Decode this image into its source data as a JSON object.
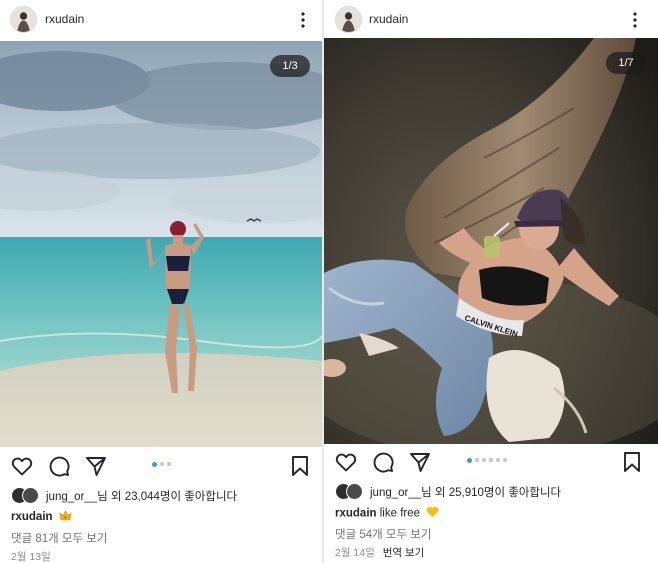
{
  "posts": [
    {
      "username": "rxudain",
      "counter": "1/3",
      "photo_alt": "beach photo",
      "slide_count": 3,
      "active_slide": 1,
      "likes_users": "jung_or__",
      "likes_text": "jung_or__님 외 23,044명이 좋아합니다",
      "caption_user": "rxudain",
      "caption_text": "",
      "caption_emoji": "crown-emoji",
      "comments": "댓글 81개 모두 보기",
      "date": "2월 13일",
      "translate": ""
    },
    {
      "username": "rxudain",
      "counter": "1/7",
      "photo_alt": "night photo under palm tree",
      "slide_count": 7,
      "active_slide": 1,
      "likes_users": "jung_or__",
      "likes_text": "jung_or__님 외 25,910명이 좋아합니다",
      "caption_user": "rxudain",
      "caption_text": " like free",
      "caption_emoji": "yellow-heart-emoji",
      "comments": "댓글 54개 모두 보기",
      "date": "2월 14일",
      "translate": "번역 보기"
    }
  ],
  "colors": {
    "active_dot": "#3897f0",
    "text": "#262626",
    "muted": "#737373"
  }
}
